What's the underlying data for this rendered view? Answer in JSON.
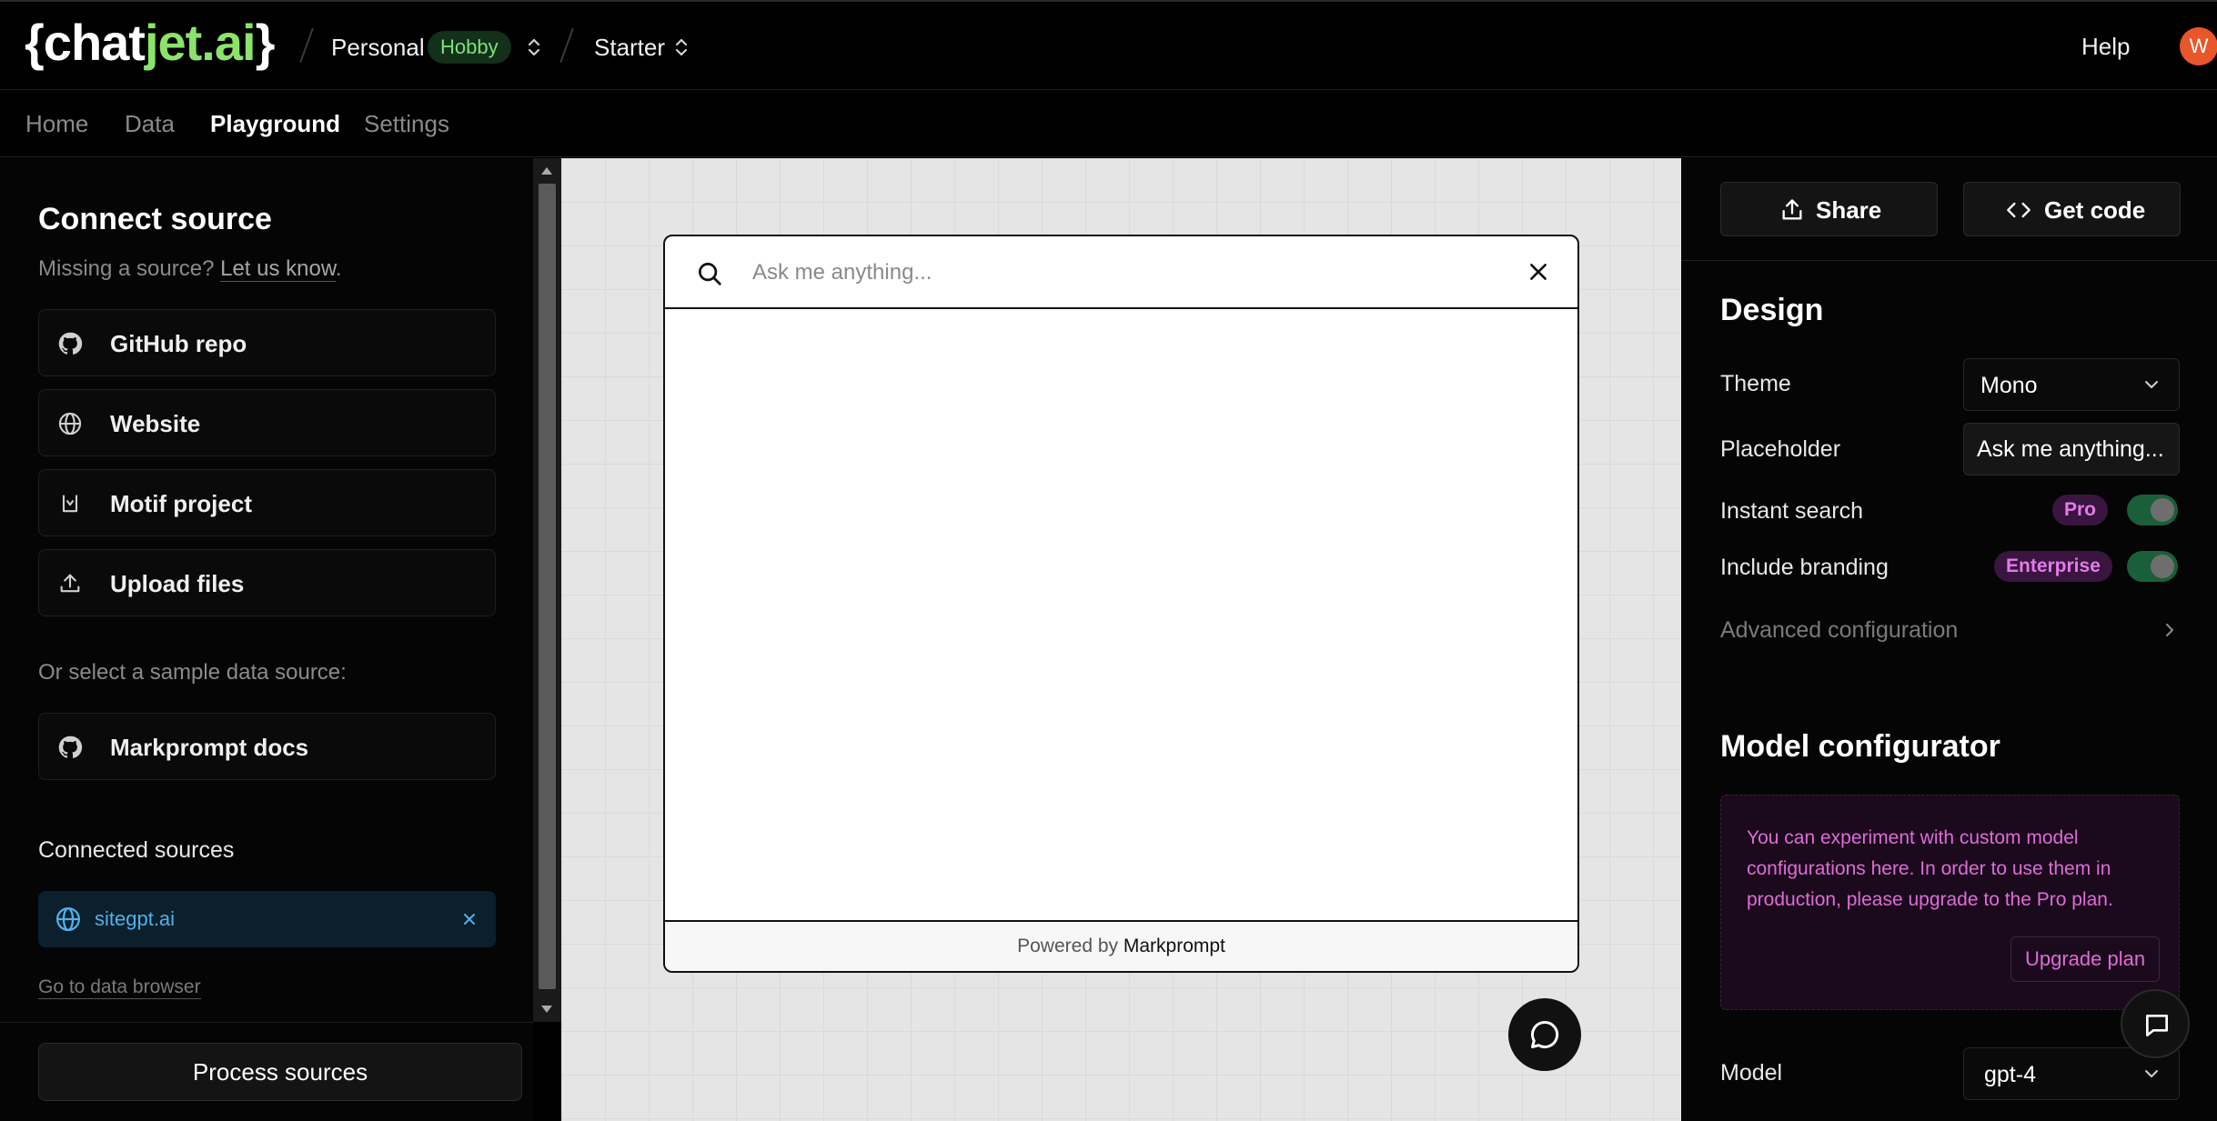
{
  "header": {
    "logo_open": "{chat",
    "logo_accent": "jet.ai",
    "logo_close": "}",
    "workspace": "Personal",
    "plan_badge": "Hobby",
    "project": "Starter",
    "help": "Help",
    "avatar_initial": "W"
  },
  "nav": {
    "tabs": [
      {
        "label": "Home"
      },
      {
        "label": "Data"
      },
      {
        "label": "Playground"
      },
      {
        "label": "Settings"
      }
    ],
    "active": "Playground"
  },
  "sidebar": {
    "title": "Connect source",
    "missing_text": "Missing a source?",
    "missing_link": "Let us know",
    "missing_period": ".",
    "sources": [
      {
        "label": "GitHub repo",
        "icon": "github-icon"
      },
      {
        "label": "Website",
        "icon": "globe-icon"
      },
      {
        "label": "Motif project",
        "icon": "motif-icon"
      },
      {
        "label": "Upload files",
        "icon": "upload-icon"
      }
    ],
    "sample_label": "Or select a sample data source:",
    "sample_source": {
      "label": "Markprompt docs",
      "icon": "github-icon"
    },
    "connected_title": "Connected sources",
    "connected": [
      {
        "label": "sitegpt.ai",
        "icon": "globe-icon"
      }
    ],
    "data_browser_link": "Go to data browser",
    "process_button": "Process sources"
  },
  "preview": {
    "search_placeholder": "Ask me anything...",
    "powered_by": "Powered by",
    "powered_brand": "Markprompt"
  },
  "right_panel": {
    "share_button": "Share",
    "get_code_button": "Get code",
    "design_title": "Design",
    "theme_label": "Theme",
    "theme_value": "Mono",
    "placeholder_label": "Placeholder",
    "placeholder_value": "Ask me anything...",
    "instant_search_label": "Instant search",
    "instant_search_badge": "Pro",
    "instant_search_on": true,
    "branding_label": "Include branding",
    "branding_badge": "Enterprise",
    "branding_on": true,
    "advanced_label": "Advanced configuration",
    "model_title": "Model configurator",
    "notice_text": "You can experiment with custom model configurations here. In order to use them in production, please upgrade to the Pro plan.",
    "upgrade_button": "Upgrade plan",
    "model_label": "Model",
    "model_value": "gpt-4"
  },
  "colors": {
    "brand_green": "#8be36a",
    "hobby_badge_bg": "#12301a",
    "connected_blue": "#4fb2ea",
    "pro_pink": "#e06bd8",
    "toggle_green": "#1a5f3a",
    "avatar_orange": "#e8562a"
  }
}
